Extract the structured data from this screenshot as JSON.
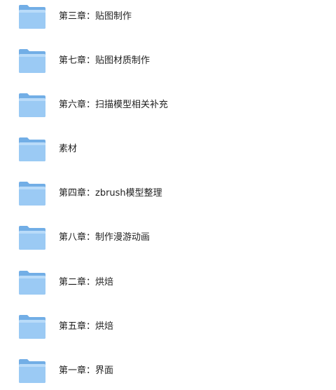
{
  "folders": [
    {
      "label": "第三章：贴图制作",
      "icon": "folder-icon"
    },
    {
      "label": "第七章：贴图材质制作",
      "icon": "folder-icon"
    },
    {
      "label": "第六章：扫描模型相关补充",
      "icon": "folder-icon"
    },
    {
      "label": "素材",
      "icon": "folder-icon"
    },
    {
      "label": "第四章：zbrush模型整理",
      "icon": "folder-icon"
    },
    {
      "label": "第八章：制作漫游动画",
      "icon": "folder-icon"
    },
    {
      "label": "第二章：烘焙",
      "icon": "folder-icon"
    },
    {
      "label": "第五章：烘焙",
      "icon": "folder-icon"
    },
    {
      "label": "第一章：界面",
      "icon": "folder-icon"
    }
  ],
  "colors": {
    "folder_back": "#72aee6",
    "folder_front_top": "#a6d1f7",
    "folder_front_bottom": "#8dc0f0",
    "text": "#1f1f1f"
  }
}
